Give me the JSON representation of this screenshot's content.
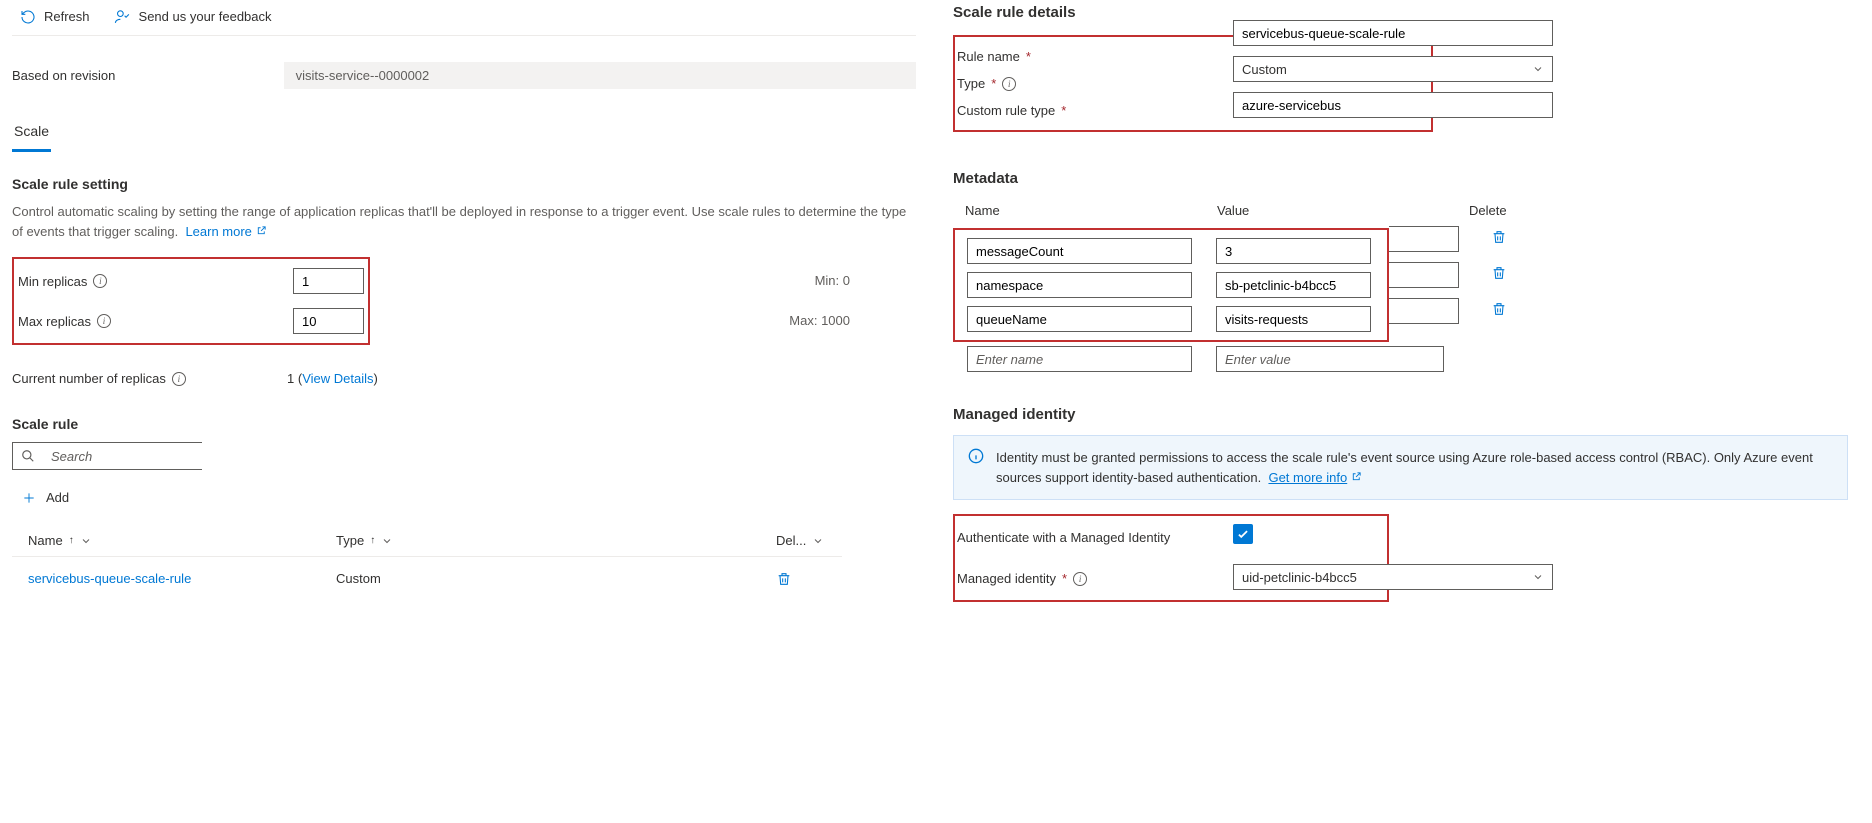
{
  "toolbar": {
    "refresh": "Refresh",
    "feedback": "Send us your feedback"
  },
  "revision": {
    "label": "Based on revision",
    "value": "visits-service--0000002"
  },
  "tabs": {
    "scale": "Scale"
  },
  "scale_setting": {
    "heading": "Scale rule setting",
    "desc": "Control automatic scaling by setting the range of application replicas that'll be deployed in response to a trigger event. Use scale rules to determine the type of events that trigger scaling.",
    "learn_more": "Learn more",
    "min_label": "Min replicas",
    "min_value": "1",
    "min_suffix": "Min: 0",
    "max_label": "Max replicas",
    "max_value": "10",
    "max_suffix": "Max: 1000",
    "current_label": "Current number of replicas",
    "current_count": "1",
    "view_details": "View Details"
  },
  "scale_rule": {
    "heading": "Scale rule",
    "search_ph": "Search",
    "add": "Add",
    "col_name": "Name",
    "col_type": "Type",
    "col_del": "Del...",
    "rows": [
      {
        "name": "servicebus-queue-scale-rule",
        "type": "Custom"
      }
    ]
  },
  "details": {
    "heading": "Scale rule details",
    "name_label": "Rule name",
    "name_value": "servicebus-queue-scale-rule",
    "type_label": "Type",
    "type_value": "Custom",
    "custom_label": "Custom rule type",
    "custom_value": "azure-servicebus"
  },
  "metadata": {
    "heading": "Metadata",
    "col_name": "Name",
    "col_value": "Value",
    "col_delete": "Delete",
    "rows": [
      {
        "name": "messageCount",
        "value": "3"
      },
      {
        "name": "namespace",
        "value": "sb-petclinic-b4bcc5"
      },
      {
        "name": "queueName",
        "value": "visits-requests"
      }
    ],
    "ph_name": "Enter name",
    "ph_value": "Enter value"
  },
  "identity": {
    "heading": "Managed identity",
    "banner": "Identity must be granted permissions to access the scale rule's event source using Azure role-based access control (RBAC). Only Azure event sources support identity-based authentication.",
    "more_info": "Get more info",
    "auth_label": "Authenticate with a Managed Identity",
    "mi_label": "Managed identity",
    "mi_value": "uid-petclinic-b4bcc5"
  }
}
